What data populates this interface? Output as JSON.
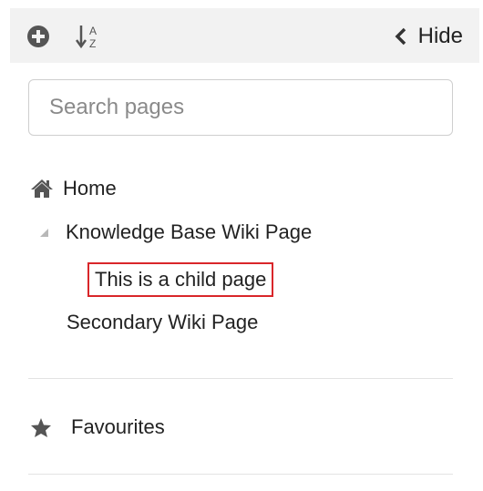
{
  "toolbar": {
    "add_icon": "plus-circle-icon",
    "sort_icon": "sort-alpha-icon",
    "sort_glyph_top": "A",
    "sort_glyph_bottom": "Z",
    "hide_label": "Hide"
  },
  "search": {
    "placeholder": "Search pages",
    "value": ""
  },
  "tree": {
    "home_label": "Home",
    "items": [
      {
        "label": "Knowledge Base Wiki Page",
        "expanded": true
      },
      {
        "label": "This is a child page",
        "highlighted": true,
        "highlight_color": "#d9262a"
      },
      {
        "label": "Secondary Wiki Page"
      }
    ]
  },
  "favourites": {
    "label": "Favourites",
    "icon": "star-icon"
  },
  "colors": {
    "toolbar_bg": "#f2f2f2",
    "highlight_border": "#d9262a",
    "icon": "#555555"
  }
}
